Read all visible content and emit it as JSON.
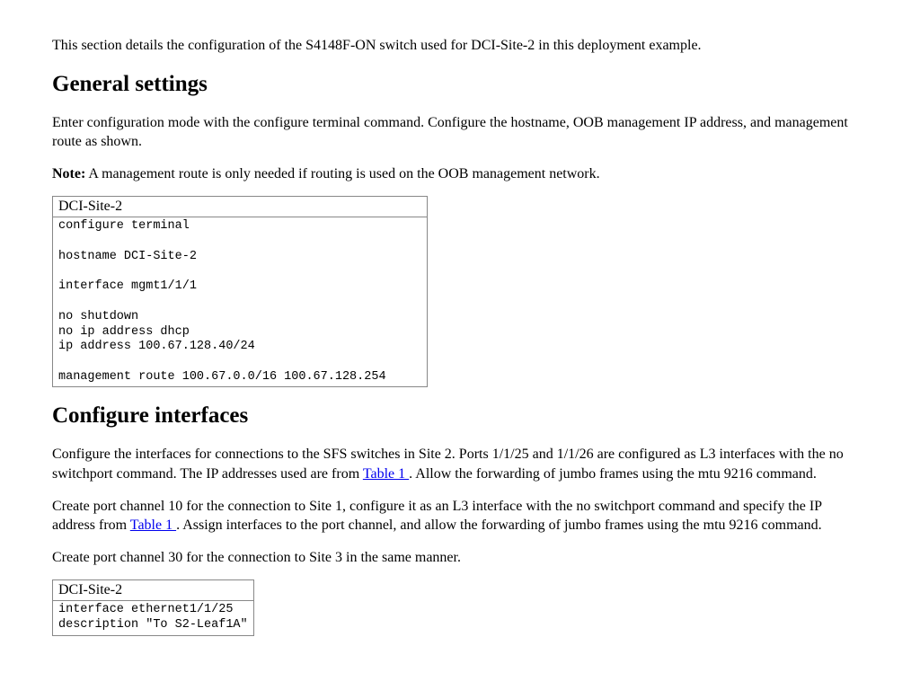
{
  "intro": "This section details the configuration of the S4148F-ON switch used for DCI-Site-2 in this deployment example.",
  "section1": {
    "heading": "General settings",
    "para1": "Enter configuration mode with the configure terminal command. Configure the hostname, OOB management IP address, and management route as shown.",
    "note_label": "Note:",
    "note_body": " A management route is only needed if routing is used on the OOB management network.",
    "code_header": "DCI-Site-2",
    "code": "configure terminal\n\nhostname DCI-Site-2\n\ninterface mgmt1/1/1\n\nno shutdown\nno ip address dhcp\nip address 100.67.128.40/24\n\nmanagement route 100.67.0.0/16 100.67.128.254"
  },
  "section2": {
    "heading": "Configure interfaces",
    "para1a": "Configure the interfaces for connections to the SFS switches in Site 2. Ports 1/1/25 and 1/1/26 are configured as L3 interfaces with the no switchport command. The IP addresses used are from ",
    "link1": "Table 1 ",
    "para1b": ". Allow the forwarding of jumbo frames using the mtu 9216 command.",
    "para2a": "Create port channel 10 for the connection to Site 1, configure it as an L3 interface with the no switchport command and specify the IP address from ",
    "link2": "Table 1 ",
    "para2b": ". Assign interfaces to the port channel, and allow the forwarding of jumbo frames using the mtu 9216 command.",
    "para3": "Create port channel 30 for the connection to Site 3 in the same manner.",
    "code_header": "DCI-Site-2",
    "code": "interface ethernet1/1/25\ndescription \"To S2-Leaf1A\""
  }
}
